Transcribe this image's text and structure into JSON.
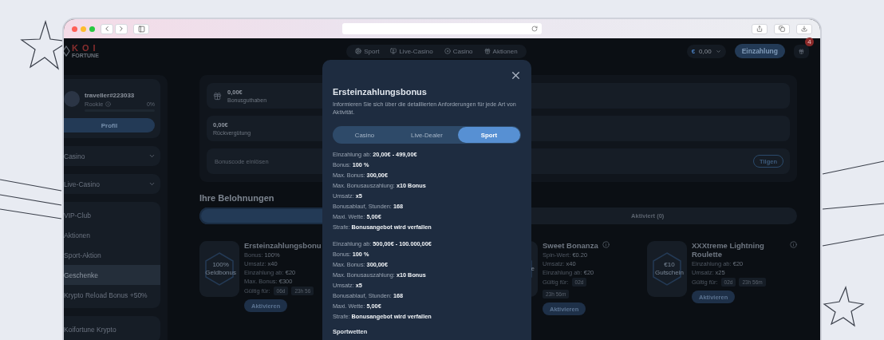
{
  "header": {
    "logo": {
      "top": "KOI",
      "bottom": "FORTUNE"
    },
    "nav": [
      {
        "label": "Sport",
        "kind": "ball"
      },
      {
        "label": "Live-Casino",
        "kind": "tv"
      },
      {
        "label": "Casino",
        "kind": "chip"
      },
      {
        "label": "Aktionen",
        "kind": "gift"
      }
    ],
    "balance": {
      "currency": "€",
      "amount": "0,00"
    },
    "deposit_button": "Einzahlung",
    "gift_badge": "4"
  },
  "sidebar": {
    "profile": {
      "username": "traveller#223033",
      "rank": "Rookie",
      "progress_text": "0%",
      "level": 0,
      "button": "Profil"
    },
    "groups": [
      [
        {
          "label": "Casino",
          "kind": "dropdown",
          "selected": false
        }
      ],
      [
        {
          "label": "Live-Casino",
          "kind": "dropdown",
          "selected": false
        }
      ],
      [
        {
          "label": "VIP-Club",
          "kind": "link",
          "selected": false
        },
        {
          "label": "Aktionen",
          "kind": "link",
          "selected": false
        },
        {
          "label": "Sport-Aktion",
          "kind": "link",
          "selected": false
        },
        {
          "label": "Geschenke",
          "kind": "link",
          "selected": true
        },
        {
          "label": "Krypto Reload Bonus +50%",
          "kind": "link",
          "selected": false
        }
      ],
      [
        {
          "label": "Koifortune Krypto",
          "kind": "link",
          "selected": false
        }
      ]
    ]
  },
  "balances": [
    {
      "amount": "0,00€",
      "label": "Bonusguthaben",
      "kind": "gift"
    },
    {
      "amount": "0,00€",
      "label": "Rückvergütung",
      "kind": "plain"
    }
  ],
  "bonus_code": {
    "placeholder": "Bonuscode einlösen",
    "button": "Tilgen"
  },
  "rewards": {
    "title": "Ihre Belohnungen",
    "tabs": [
      {
        "selected": true
      },
      {
        "label": "Aktiviert (0)",
        "selected": false
      }
    ],
    "cards": [
      {
        "badge": [
          "100%",
          "Geldbonus"
        ],
        "title": "Ersteinzahlungsbonu",
        "info": false,
        "details": [
          {
            "label": "Bonus:",
            "value": "100%"
          },
          {
            "label": "Umsatz:",
            "value": "x40"
          },
          {
            "label": "Einzahlung ab:",
            "value": "€20"
          },
          {
            "label": "Max. Bonus:",
            "value": "€300"
          }
        ],
        "valid_label": "Gültig für:",
        "chips": [
          "06d",
          "23h 56"
        ],
        "button": "Aktivieren"
      },
      {
        "badge": [
          "e"
        ],
        "title": "Sweet Bonanza",
        "info": true,
        "details": [
          {
            "label": "Spin-Wert:",
            "value": "€0.20"
          },
          {
            "label": "Umsatz:",
            "value": "x40"
          },
          {
            "label": "Einzahlung ab:",
            "value": "€20"
          }
        ],
        "valid_label": "Gültig für:",
        "chips": [
          "02d",
          "23h 56m"
        ],
        "button": "Aktivieren"
      },
      {
        "badge": [
          "€10",
          "Gutschein"
        ],
        "title": "XXXtreme Lightning Roulette",
        "info": true,
        "details": [
          {
            "label": "Einzahlung ab:",
            "value": "€20"
          },
          {
            "label": "Umsatz:",
            "value": "x25"
          }
        ],
        "valid_label": "Gültig für:",
        "chips": [
          "02d",
          "23h 56m"
        ],
        "button": "Aktivieren"
      }
    ]
  },
  "modal": {
    "title": "Ersteinzahlungsbonus",
    "description": "Informieren Sie sich über die detaillierten Anforderungen für jede Art von Aktivität.",
    "tabs": [
      {
        "label": "Casino",
        "selected": false
      },
      {
        "label": "Live-Dealer",
        "selected": false
      },
      {
        "label": "Sport",
        "selected": true
      }
    ],
    "sections": [
      [
        "Einzahlung ab: **20,00€ - 499,00€**",
        "Bonus: **100 %**",
        "Max. Bonus: **300,00€**",
        "Max. Bonusauszahlung: **x10 Bonus**",
        "Umsatz: **x5**",
        "Bonusablauf, Stunden: **168**",
        "Maxi. Wette: **5,00€**",
        "Strafe: **Bonusangebot wird verfallen**"
      ],
      [
        "Einzahlung ab: **500,00€ - 100.000,00€**",
        "Bonus: **100 %**",
        "Max. Bonus: **300,00€**",
        "Max. Bonusauszahlung: **x10 Bonus**",
        "Umsatz: **x5**",
        "Bonusablauf, Stunden: **168**",
        "Maxi. Wette: **5,00€**",
        "Strafe: **Bonusangebot wird verfallen**"
      ]
    ],
    "subheading": "Sportwetten"
  }
}
